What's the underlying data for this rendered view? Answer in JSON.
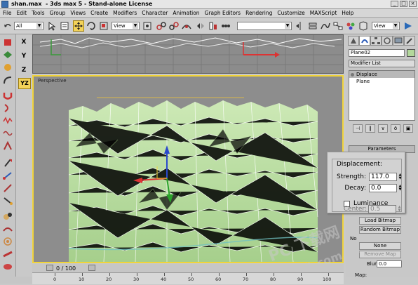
{
  "window": {
    "title": "shan.max  - 3ds max 5 - Stand-alone License"
  },
  "menu": {
    "items": [
      "File",
      "Edit",
      "Tools",
      "Group",
      "Views",
      "Create",
      "Modifiers",
      "Character",
      "Animation",
      "Graph Editors",
      "Rendering",
      "Customize",
      "MAXScript",
      "Help"
    ]
  },
  "toolbar": {
    "selection_filter": "All",
    "ref_coord": "View",
    "named_sel": "",
    "viewport_render": "View"
  },
  "axis_constraints": [
    "X",
    "Y",
    "Z",
    "YZ"
  ],
  "viewports": {
    "perspective_label": "Perspective"
  },
  "command_panel": {
    "object_name": "Plane02",
    "modifier_list": "Modifier List",
    "stack": [
      {
        "label": "Displace",
        "active": true
      },
      {
        "label": "Plane",
        "active": false
      }
    ],
    "parameters_title": "Parameters",
    "buttons": [
      "Load Bitmap",
      "Random Bitmap",
      "None",
      "Remove Map"
    ],
    "blur_label": "Blur:",
    "blur_value": "0.0",
    "map_label": "Map:",
    "no_label": "No"
  },
  "displacement": {
    "title": "Displacement:",
    "strength_label": "Strength:",
    "strength_value": "117.0",
    "decay_label": "Decay:",
    "decay_value": "0.0",
    "luminance_label": "Luminance",
    "center_label": "Center:",
    "center_value": "0.5"
  },
  "timeline": {
    "frame": "0 / 100",
    "ticks": [
      "0",
      "10",
      "20",
      "30",
      "40",
      "50",
      "60",
      "70",
      "80",
      "90",
      "100"
    ]
  },
  "watermark": {
    "text1": "PC 下载网",
    "text2": "pcsoft.com.cn"
  },
  "colors": {
    "accent_selection": "#f1d43a",
    "mesh": "#b8dca0",
    "wire": "#ffffff"
  }
}
